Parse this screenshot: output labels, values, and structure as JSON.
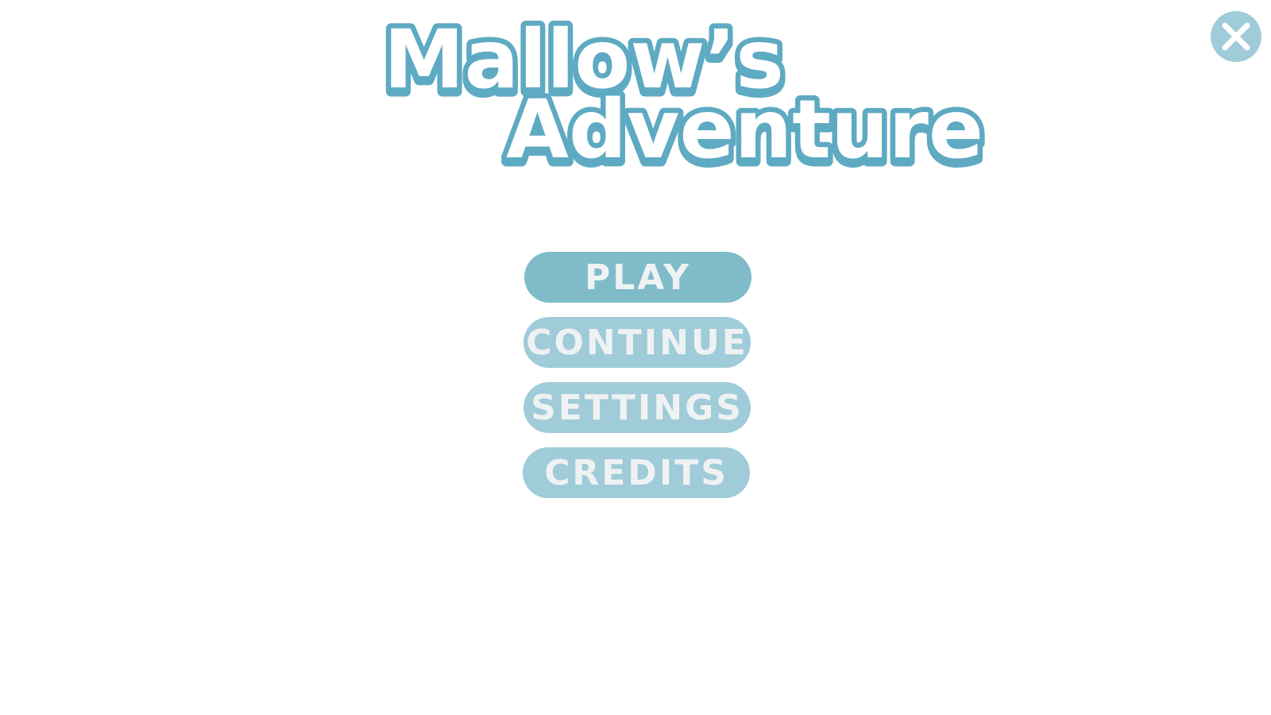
{
  "game": {
    "title_line1": "Mallow’s",
    "title_line2": "Adventure"
  },
  "menu": {
    "play_label": "PLAY",
    "continue_label": "CONTINUE",
    "settings_label": "SETTINGS",
    "credits_label": "CREDITS"
  },
  "icons": {
    "close": "close-icon"
  },
  "colors": {
    "background": "#ffffff",
    "title_outline": "#5eaac2",
    "button_primary": "#80bbca",
    "button_secondary": "#a0cbd8",
    "button_text": "#eef2f3"
  }
}
